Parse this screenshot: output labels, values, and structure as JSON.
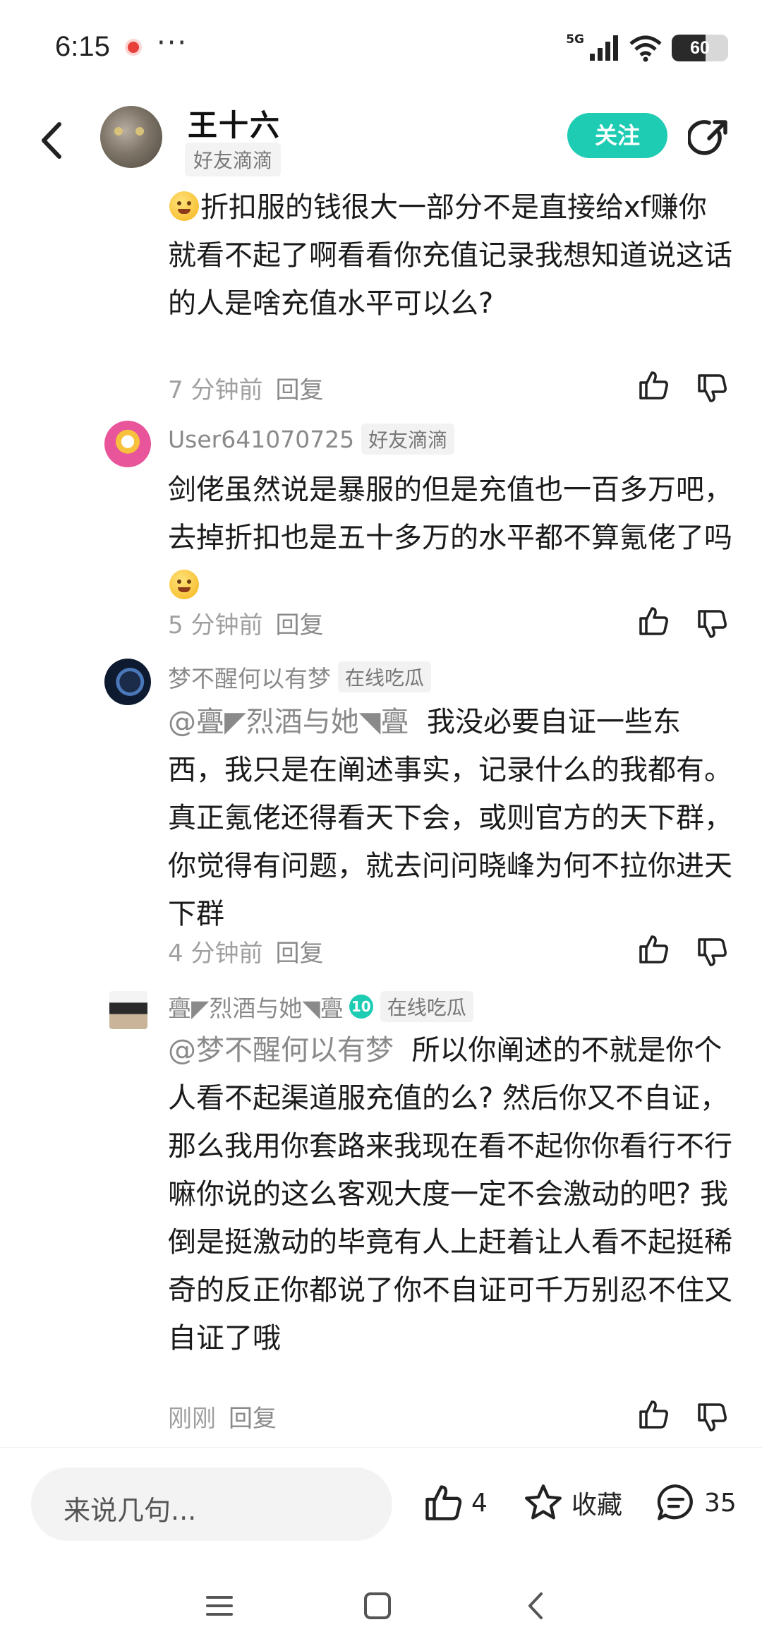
{
  "status_bar": {
    "time": "6:15",
    "more": "···",
    "network": "5G",
    "battery": "60",
    "battery_level": 0.6
  },
  "header": {
    "author_name": "王十六",
    "author_tag": "好友滴滴",
    "follow_label": "关注"
  },
  "comments": [
    {
      "user": "",
      "tag": "",
      "text": "折扣服的钱很大一部分不是直接给xf赚你就看不起了啊看看你充值记录我想知道说这话的人是啥充值水平可以么?",
      "time": "7 分钟前",
      "reply": "回复"
    },
    {
      "user": "User641070725",
      "tag": "好友滴滴",
      "text": "剑佬虽然说是暴服的但是充值也一百多万吧，去掉折扣也是五十多万的水平都不算氪佬了吗",
      "time": "5 分钟前",
      "reply": "回复"
    },
    {
      "user": "梦不醒何以有梦",
      "tag": "在线吃瓜",
      "mention": "@亹◤烈酒与她◥亹",
      "text": "我没必要自证一些东西，我只是在阐述事实，记录什么的我都有。真正氪佬还得看天下会，或则官方的天下群，你觉得有问题，就去问问晓峰为何不拉你进天下群",
      "time": "4 分钟前",
      "reply": "回复"
    },
    {
      "user": "亹◤烈酒与她◥亹",
      "level": "10",
      "tag": "在线吃瓜",
      "mention": "@梦不醒何以有梦",
      "text": "所以你阐述的不就是你个人看不起渠道服充值的么? 然后你又不自证，那么我用你套路来我现在看不起你你看行不行嘛你说的这么客观大度一定不会激动的吧? 我倒是挺激动的毕竟有人上赶着让人看不起挺稀奇的反正你都说了你不自证可千万别忍不住又自证了哦",
      "time": "刚刚",
      "reply": "回复"
    }
  ],
  "bottom_bar": {
    "input_placeholder": "来说几句...",
    "like_count": "4",
    "favorite_label": "收藏",
    "comment_count": "35"
  },
  "icons": {
    "back": "back-arrow-icon",
    "share": "share-icon",
    "like": "thumbs-up-icon",
    "dislike": "thumbs-down-icon",
    "favorite": "star-icon",
    "comment": "comment-bubble-icon"
  },
  "colors": {
    "accent": "#1ecbb3",
    "text_primary": "#1a1a1a",
    "text_secondary": "#8a8a8a"
  }
}
